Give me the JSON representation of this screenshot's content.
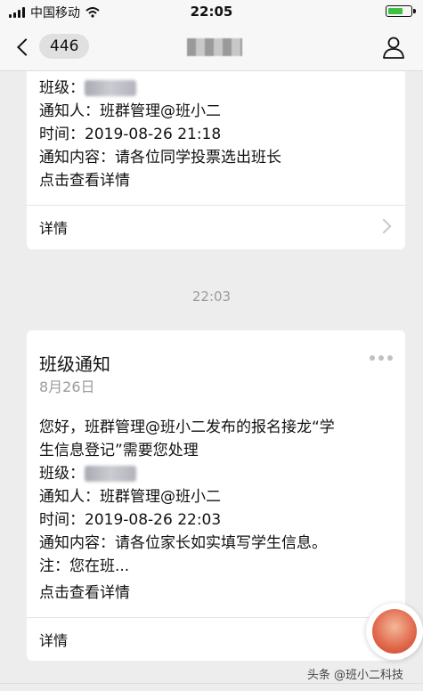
{
  "status": {
    "carrier": "中国移动",
    "time": "22:05"
  },
  "nav": {
    "back_count": "446"
  },
  "card1": {
    "class_label": "班级：",
    "notifier": "通知人：班群管理@班小二",
    "time_label": "时间：",
    "time_value": "2019-08-26 21:18",
    "content_label": "通知内容：",
    "content_value": "请各位同学投票选出班长",
    "click_link": "点击查看详情",
    "detail_label": "详情"
  },
  "timestamp": "22:03",
  "card2": {
    "title": "班级通知",
    "date": "8月26日",
    "line1": "您好，班群管理@班小二发布的报名接龙“学",
    "line2": "生信息登记”需要您处理",
    "class_label": "班级：",
    "notifier": "通知人：班群管理@班小二",
    "time_label": "时间：",
    "time_value": "2019-08-26 22:03",
    "content_label": "通知内容：",
    "content_value": "请各位家长如实填写学生信息。",
    "note": "注：您在班...",
    "click_link": "点击查看详情",
    "detail_label": "详情"
  },
  "watermark": "头条 @班小二科技",
  "icons": {
    "back": "chevron-left-icon",
    "profile": "person-icon",
    "more": "more-dots-icon",
    "arrow": "chevron-right-icon"
  },
  "colors": {
    "link": "#4a5f8e",
    "background": "#ededed",
    "battery": "#3ec040"
  }
}
